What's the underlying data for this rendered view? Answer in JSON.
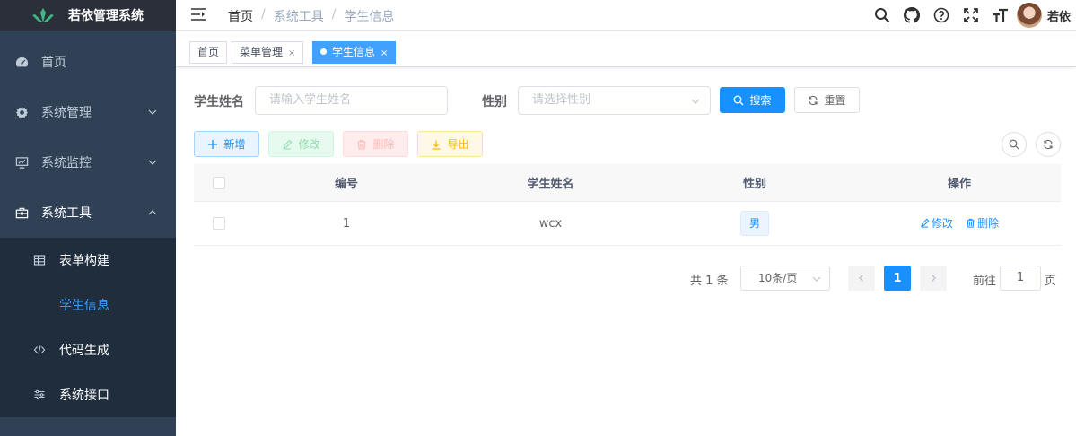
{
  "app": {
    "title": "若依管理系统"
  },
  "sidebar": {
    "items": [
      {
        "label": "首页",
        "icon": "dashboard-icon"
      },
      {
        "label": "系统管理",
        "icon": "gear-icon"
      },
      {
        "label": "系统监控",
        "icon": "monitor-icon"
      },
      {
        "label": "系统工具",
        "icon": "toolbox-icon"
      }
    ],
    "submenu": [
      {
        "label": "表单构建",
        "icon": "table-icon"
      },
      {
        "label": "学生信息",
        "icon": ""
      },
      {
        "label": "代码生成",
        "icon": "code-icon"
      },
      {
        "label": "系统接口",
        "icon": "sliders-icon"
      }
    ]
  },
  "navbar": {
    "breadcrumb": [
      "首页",
      "系统工具",
      "学生信息"
    ],
    "username": "若依",
    "icons": [
      "search-icon",
      "github-icon",
      "help-icon",
      "fullscreen-icon",
      "font-size-icon"
    ]
  },
  "tags": {
    "items": [
      {
        "label": "首页"
      },
      {
        "label": "菜单管理",
        "close": "×"
      },
      {
        "label": "学生信息",
        "close": "×"
      }
    ]
  },
  "search": {
    "name_label": "学生姓名",
    "name_placeholder": "请输入学生姓名",
    "gender_label": "性别",
    "gender_placeholder": "请选择性别",
    "search_btn": "搜索",
    "reset_btn": "重置"
  },
  "toolbar": {
    "add": "新增",
    "edit": "修改",
    "delete": "删除",
    "export": "导出"
  },
  "table": {
    "columns": [
      "编号",
      "学生姓名",
      "性别",
      "操作"
    ],
    "rows": [
      {
        "id": "1",
        "name": "wcx",
        "gender": "男",
        "edit": "修改",
        "delete": "删除"
      }
    ]
  },
  "pagination": {
    "total": "共 1 条",
    "page_size": "10条/页",
    "current_page": "1",
    "goto_label": "前往",
    "goto_value": "1",
    "goto_suffix": "页"
  },
  "colors": {
    "sidebar_bg": "#304156",
    "primary": "#1890ff",
    "tag_active": "#42a0ff"
  }
}
